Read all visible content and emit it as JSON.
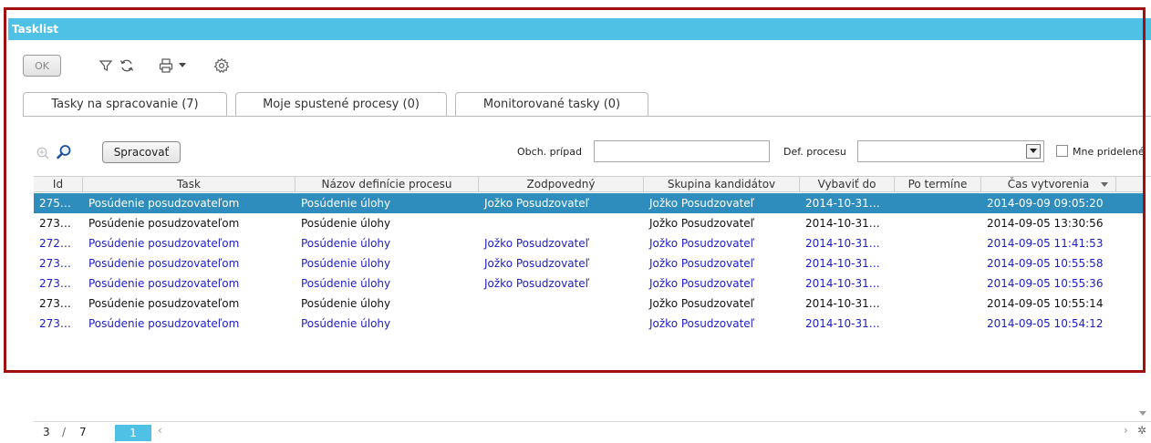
{
  "window": {
    "title": "Tasklist"
  },
  "toolbar": {
    "ok_label": "OK",
    "icons": [
      "filter-icon",
      "refresh-icon",
      "print-icon",
      "settings-icon"
    ]
  },
  "tabs": [
    {
      "label": "Tasky na spracovanie (7)",
      "active": true
    },
    {
      "label": "Moje spustené procesy (0)",
      "active": false
    },
    {
      "label": "Monitorované tasky (0)",
      "active": false
    }
  ],
  "filters": {
    "process_button": "Spracovať",
    "case_label": "Obch. prípad",
    "case_value": "",
    "process_def_label": "Def. procesu",
    "process_def_value": "",
    "assigned_label": "Mne pridelené"
  },
  "grid": {
    "columns": [
      "Id",
      "Task",
      "Názov definície procesu",
      "Zodpovedný",
      "Skupina kandidátov",
      "Vybaviť do",
      "Po termíne",
      "Čas vytvorenia"
    ],
    "rows": [
      {
        "id": "275…",
        "task": "Posúdenie posudzovateľom",
        "process": "Posúdenie úlohy",
        "owner": "Jožko Posudzovateľ",
        "group": "Jožko Posudzovateľ",
        "due": "2014-10-31…",
        "overdue": "",
        "created": "2014-09-09 09:05:20",
        "selected": true,
        "color": "blue"
      },
      {
        "id": "273…",
        "task": "Posúdenie posudzovateľom",
        "process": "Posúdenie úlohy",
        "owner": "",
        "group": "Jožko Posudzovateľ",
        "due": "2014-10-31…",
        "overdue": "",
        "created": "2014-09-05 13:30:56",
        "selected": false,
        "color": "black"
      },
      {
        "id": "272…",
        "task": "Posúdenie posudzovateľom",
        "process": "Posúdenie úlohy",
        "owner": "Jožko Posudzovateľ",
        "group": "Jožko Posudzovateľ",
        "due": "2014-10-31…",
        "overdue": "",
        "created": "2014-09-05 11:41:53",
        "selected": false,
        "color": "blue"
      },
      {
        "id": "273…",
        "task": "Posúdenie posudzovateľom",
        "process": "Posúdenie úlohy",
        "owner": "Jožko Posudzovateľ",
        "group": "Jožko Posudzovateľ",
        "due": "2014-10-31…",
        "overdue": "",
        "created": "2014-09-05 10:55:58",
        "selected": false,
        "color": "blue"
      },
      {
        "id": "273…",
        "task": "Posúdenie posudzovateľom",
        "process": "Posúdenie úlohy",
        "owner": "Jožko Posudzovateľ",
        "group": "Jožko Posudzovateľ",
        "due": "2014-10-31…",
        "overdue": "",
        "created": "2014-09-05 10:55:36",
        "selected": false,
        "color": "blue"
      },
      {
        "id": "273…",
        "task": "Posúdenie posudzovateľom",
        "process": "Posúdenie úlohy",
        "owner": "",
        "group": "Jožko Posudzovateľ",
        "due": "2014-10-31…",
        "overdue": "",
        "created": "2014-09-05 10:55:14",
        "selected": false,
        "color": "black"
      },
      {
        "id": "273…",
        "task": "Posúdenie posudzovateľom",
        "process": "Posúdenie úlohy",
        "owner": "",
        "group": "Jožko Posudzovateľ",
        "due": "2014-10-31…",
        "overdue": "",
        "created": "2014-09-05 10:54:12",
        "selected": false,
        "color": "blue"
      }
    ]
  },
  "pager": {
    "current": "3",
    "separator": "/",
    "total": "7",
    "page_button": "1"
  },
  "colors": {
    "titlebar": "#4fc1e5",
    "selection": "#2f8dbd",
    "link_blue": "#1d1dc8",
    "frame": "#a01010"
  }
}
